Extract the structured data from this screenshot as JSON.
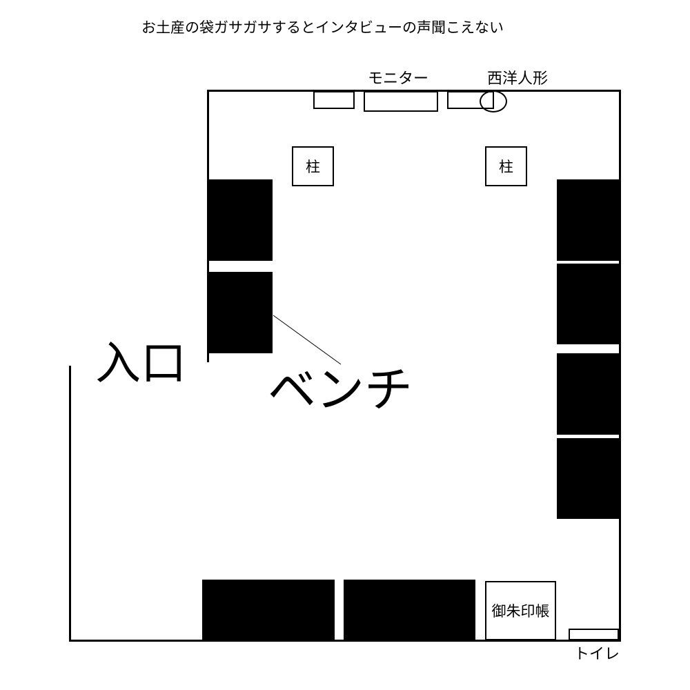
{
  "title": "お土産の袋ガサガサするとインタビューの声聞こえない",
  "labels": {
    "monitor": "モニター",
    "doll": "西洋人形",
    "pillar_left": "柱",
    "pillar_right": "柱",
    "entrance": "入口",
    "bench": "ベンチ",
    "goshuin": "御朱印帳",
    "toilet": "トイレ"
  }
}
